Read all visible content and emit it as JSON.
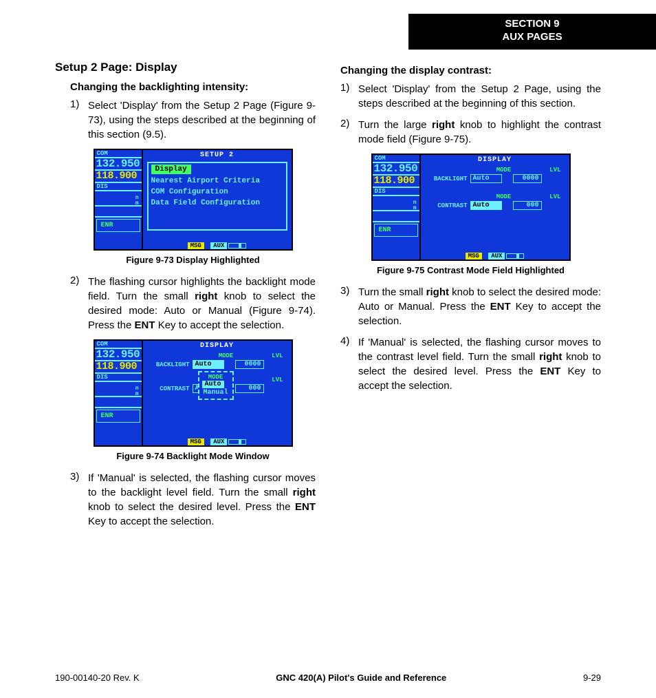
{
  "banner": {
    "line1": "SECTION 9",
    "line2": "AUX PAGES"
  },
  "left": {
    "h2": "Setup 2 Page: Display",
    "h3": "Changing the backlighting intensity:",
    "steps": [
      {
        "n": "1)",
        "t": "Select 'Display' from the Setup 2 Page (Figure 9-73), using the steps described at the beginning of this section (9.5)."
      },
      {
        "n": "2)",
        "t": "The flashing cursor highlights the backlight mode field.  Turn the small <b>right</b> knob to select the desired mode: Auto or Manual (Figure 9-74).  Press the <b>ENT</b> Key to accept the selection."
      },
      {
        "n": "3)",
        "t": "If 'Manual' is selected, the flashing cursor moves to the backlight level field.  Turn the small <b>right</b> knob to select the desired level.  Press the <b>ENT</b> Key to accept the selection."
      }
    ],
    "fig73": {
      "caption": "Figure 9-73  Display Highlighted",
      "panel_title": "SETUP 2",
      "com_lbl": "COM",
      "com1": "132.950",
      "com2": "118.900",
      "dis_lbl": "DIS",
      "nm": "n\nm",
      "enr": "ENR",
      "items": [
        "Display",
        "Nearest Airport Criteria",
        "COM Configuration",
        "Data Field Configuration"
      ],
      "msg": "MSG",
      "aux": "AUX"
    },
    "fig74": {
      "caption": "Figure 9-74  Backlight Mode Window",
      "panel_title": "DISPLAY",
      "com_lbl": "COM",
      "com1": "132.950",
      "com2": "118.900",
      "dis_lbl": "DIS",
      "enr": "ENR",
      "hdr_mode": "MODE",
      "hdr_lvl": "LVL",
      "backlight_lbl": "BACKLIGHT",
      "backlight_val": "Auto",
      "backlight_lvl": "0000",
      "contrast_lbl": "CONTRAST",
      "contrast_val": "A",
      "contrast_lvl": "000",
      "popup_title": "MODE",
      "popup_opts": [
        "Auto",
        "Manual"
      ],
      "msg": "MSG",
      "aux": "AUX"
    }
  },
  "right": {
    "h3": "Changing the display contrast:",
    "steps": [
      {
        "n": "1)",
        "t": "Select 'Display' from the Setup 2 Page, using the steps described at the beginning of this section."
      },
      {
        "n": "2)",
        "t": "Turn the large <b>right</b> knob to highlight the contrast mode field (Figure 9-75)."
      },
      {
        "n": "3)",
        "t": "Turn the small <b>right</b> knob to select the desired mode: Auto or Manual.  Press the <b>ENT</b> Key to accept the selection."
      },
      {
        "n": "4)",
        "t": "If 'Manual' is selected, the flashing cursor moves to the contrast level field.  Turn the small <b>right</b> knob to select the desired level.  Press the <b>ENT</b> Key to accept the selection."
      }
    ],
    "fig75": {
      "caption": "Figure 9-75  Contrast Mode Field Highlighted",
      "panel_title": "DISPLAY",
      "com_lbl": "COM",
      "com1": "132.950",
      "com2": "118.900",
      "dis_lbl": "DIS",
      "enr": "ENR",
      "hdr_mode": "MODE",
      "hdr_lvl": "LVL",
      "backlight_lbl": "BACKLIGHT",
      "backlight_val": "Auto",
      "backlight_lvl": "0000",
      "contrast_lbl": "CONTRAST",
      "contrast_val": "Auto",
      "contrast_lvl": "000",
      "msg": "MSG",
      "aux": "AUX"
    }
  },
  "footer": {
    "left": "190-00140-20  Rev. K",
    "center": "GNC 420(A) Pilot's Guide and Reference",
    "right": "9-29"
  }
}
